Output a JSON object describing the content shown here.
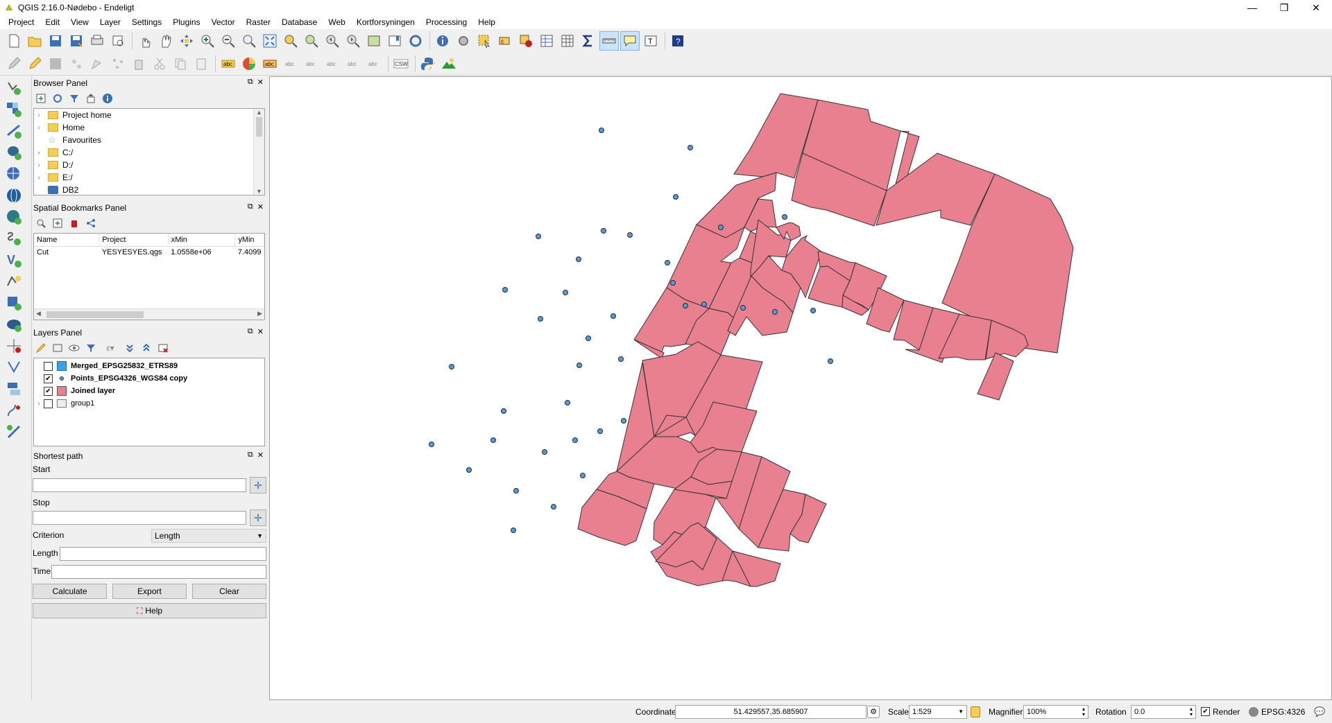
{
  "window": {
    "title": "QGIS 2.16.0-Nødebo - Endeligt",
    "min": "—",
    "max": "❐",
    "close": "✕"
  },
  "menu": [
    "Project",
    "Edit",
    "View",
    "Layer",
    "Settings",
    "Plugins",
    "Vector",
    "Raster",
    "Database",
    "Web",
    "Kortforsyningen",
    "Processing",
    "Help"
  ],
  "browser": {
    "title": "Browser Panel",
    "items": [
      {
        "label": "Project home",
        "icon": "folder-icon"
      },
      {
        "label": "Home",
        "icon": "folder-icon"
      },
      {
        "label": "Favourites",
        "icon": "star-icon"
      },
      {
        "label": "C:/",
        "icon": "folder-icon"
      },
      {
        "label": "D:/",
        "icon": "folder-icon"
      },
      {
        "label": "E:/",
        "icon": "folder-icon"
      },
      {
        "label": "DB2",
        "icon": "database-icon"
      }
    ]
  },
  "bookmarks": {
    "title": "Spatial Bookmarks Panel",
    "columns": [
      "Name",
      "Project",
      "xMin",
      "yMin"
    ],
    "rows": [
      [
        "Cut",
        "YESYESYES.qgs",
        "1.0558e+06",
        "7.4099"
      ]
    ]
  },
  "layers": {
    "title": "Layers Panel",
    "items": [
      {
        "label": "Merged_EPSG25832_ETRS89",
        "checked": false,
        "color": "#3aa0e8",
        "bold": true
      },
      {
        "label": "Points_EPSG4326_WGS84 copy",
        "checked": true,
        "color": "#5b9bd5",
        "bold": true
      },
      {
        "label": "Joined layer",
        "checked": true,
        "color": "#e8808f",
        "bold": true
      },
      {
        "label": "group1",
        "checked": false,
        "color": "",
        "bold": false
      }
    ]
  },
  "shortest": {
    "title": "Shortest path",
    "start_label": "Start",
    "stop_label": "Stop",
    "criterion_label": "Criterion",
    "criterion_value": "Length",
    "length_label": "Length",
    "time_label": "Time",
    "calculate": "Calculate",
    "export": "Export",
    "clear": "Clear",
    "help": "Help"
  },
  "status": {
    "coordinate_label": "Coordinate",
    "coordinate_value": "51.429557,35.685907",
    "scale_label": "Scale",
    "scale_value": "1:529",
    "magnifier_label": "Magnifier",
    "magnifier_value": "100%",
    "rotation_label": "Rotation",
    "rotation_value": "0.0",
    "render_label": "Render",
    "crs": "EPSG:4326"
  },
  "colors": {
    "polygon_fill": "#e8808f",
    "polygon_stroke": "#333333",
    "point_fill": "#5b9bd5"
  }
}
